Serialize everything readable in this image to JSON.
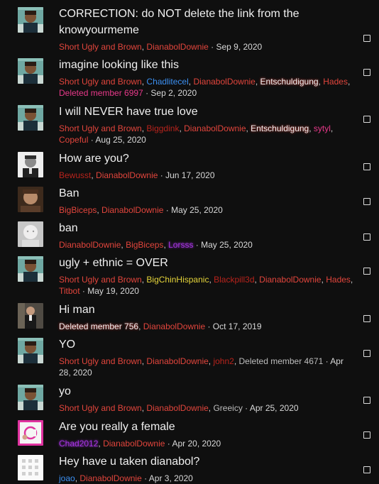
{
  "threads": [
    {
      "title": "CORRECTION: do NOT delete the link from the knowyourmeme",
      "avatar": "avatar-man-selfie",
      "participants": [
        {
          "name": "Short Ugly and Brown",
          "style": "red"
        },
        {
          "name": "DianabolDownie",
          "style": "red"
        }
      ],
      "date": "Sep 9, 2020"
    },
    {
      "title": "imagine looking like this",
      "avatar": "avatar-man-selfie",
      "participants": [
        {
          "name": "Short Ugly and Brown",
          "style": "red"
        },
        {
          "name": "Chadlitecel",
          "style": "blue"
        },
        {
          "name": "DianabolDownie",
          "style": "red"
        },
        {
          "name": "Entschuldigung",
          "style": "white"
        },
        {
          "name": "Hades",
          "style": "red"
        },
        {
          "name": "Deleted member 6997",
          "style": "pink"
        }
      ],
      "date": "Sep 2, 2020"
    },
    {
      "title": "I will NEVER have true love",
      "avatar": "avatar-man-selfie",
      "participants": [
        {
          "name": "Short Ugly and Brown",
          "style": "red"
        },
        {
          "name": "Biggdink",
          "style": "darkred"
        },
        {
          "name": "DianabolDownie",
          "style": "red"
        },
        {
          "name": "Entschuldigung",
          "style": "white"
        },
        {
          "name": "sytyl",
          "style": "pink"
        },
        {
          "name": "Copeful",
          "style": "red"
        }
      ],
      "date": "Aug 25, 2020"
    },
    {
      "title": "How are you?",
      "avatar": "avatar-bw-portrait",
      "participants": [
        {
          "name": "Bewusst",
          "style": "darkred"
        },
        {
          "name": "DianabolDownie",
          "style": "red"
        }
      ],
      "date": "Jun 17, 2020"
    },
    {
      "title": "Ban",
      "avatar": "avatar-face-photo",
      "participants": [
        {
          "name": "BigBiceps",
          "style": "red"
        },
        {
          "name": "DianabolDownie",
          "style": "red"
        }
      ],
      "date": "May 25, 2020"
    },
    {
      "title": "ban",
      "avatar": "avatar-pale-face",
      "participants": [
        {
          "name": "DianabolDownie",
          "style": "red"
        },
        {
          "name": "BigBiceps",
          "style": "red"
        },
        {
          "name": "Lorsss",
          "style": "purple"
        }
      ],
      "date": "May 25, 2020"
    },
    {
      "title": "ugly + ethnic = OVER",
      "avatar": "avatar-man-selfie",
      "participants": [
        {
          "name": "Short Ugly and Brown",
          "style": "red"
        },
        {
          "name": "BigChinHispanic",
          "style": "yellow"
        },
        {
          "name": "Blackpill3d",
          "style": "darkred"
        },
        {
          "name": "DianabolDownie",
          "style": "red"
        },
        {
          "name": "Hades",
          "style": "red"
        },
        {
          "name": "Titbot",
          "style": "red"
        }
      ],
      "date": "May 19, 2020"
    },
    {
      "title": "Hi man",
      "avatar": "avatar-suit-man",
      "participants": [
        {
          "name": "Deleted member 756",
          "style": "white"
        },
        {
          "name": "DianabolDownie",
          "style": "red"
        }
      ],
      "date": "Oct 17, 2019"
    },
    {
      "title": "YO",
      "avatar": "avatar-man-selfie",
      "participants": [
        {
          "name": "Short Ugly and Brown",
          "style": "red"
        },
        {
          "name": "DianabolDownie",
          "style": "red"
        },
        {
          "name": "john2",
          "style": "darkred"
        },
        {
          "name": "Deleted member 4671",
          "style": "strike"
        }
      ],
      "date": "Apr 28, 2020"
    },
    {
      "title": "yo",
      "avatar": "avatar-man-selfie",
      "participants": [
        {
          "name": "Short Ugly and Brown",
          "style": "red"
        },
        {
          "name": "DianabolDownie",
          "style": "red"
        },
        {
          "name": "Greeicy",
          "style": "strike"
        }
      ],
      "date": "Apr 25, 2020"
    },
    {
      "title": "Are you really a female",
      "avatar": "avatar-pink-letter",
      "participants": [
        {
          "name": "Chad2012",
          "style": "purple"
        },
        {
          "name": "DianabolDownie",
          "style": "red"
        }
      ],
      "date": "Apr 20, 2020"
    },
    {
      "title": "Hey have u taken dianabol?",
      "avatar": "avatar-white-grid",
      "participants": [
        {
          "name": "joao",
          "style": "blue"
        },
        {
          "name": "DianabolDownie",
          "style": "red"
        }
      ],
      "date": "Apr 3, 2020"
    }
  ],
  "colors": {
    "background": "#0f0f0f",
    "username_red": "#e2453c",
    "username_blue": "#3b8ff1",
    "username_pink": "#e8398a",
    "username_yellow": "#e6d53a",
    "username_purple": "#a534e0"
  }
}
